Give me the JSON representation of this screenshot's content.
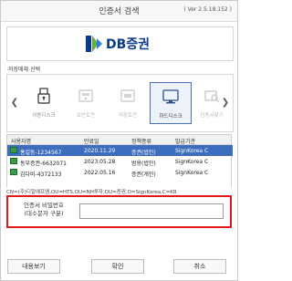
{
  "window": {
    "title": "인증서 검색",
    "version": "( Ver 2.5.18.152 )"
  },
  "logo": {
    "text": "DB증권"
  },
  "media": {
    "section_label": "저장매체 선택",
    "items": [
      {
        "label": "이동디스크",
        "icon": "usb-icon",
        "selected": false
      },
      {
        "label": "보안토큰",
        "icon": "token-icon",
        "selected": false
      },
      {
        "label": "저장토큰",
        "icon": "storage-token-icon",
        "selected": false
      },
      {
        "label": "하드디스크",
        "icon": "monitor-icon",
        "selected": true
      },
      {
        "label": "인증서찾기",
        "icon": "search-cert-icon",
        "selected": false
      }
    ]
  },
  "table": {
    "headers": [
      "사용자명",
      "만료일",
      "정책종류",
      "발급기관"
    ],
    "rows": [
      {
        "user": "홍길동-1234567",
        "expiry": "2020.11.29",
        "policy": "증권(법인)",
        "issuer": "SignKorea C",
        "selected": true
      },
      {
        "user": "동부증권-6632071",
        "expiry": "2023.05.28",
        "policy": "범용(법인)",
        "issuer": "SignKorea C",
        "selected": false
      },
      {
        "user": "김다비-4372133",
        "expiry": "2022.05.16",
        "policy": "증권(개인)",
        "issuer": "SignKorea C",
        "selected": false
      }
    ]
  },
  "dn": "CN=(주)디알에프엠,OU=HTS,OU=NH투자,OU=증권,O=SignKorea,C=KR",
  "password": {
    "label": "인증서 비밀번호\n(대소문자 구분)",
    "value": ""
  },
  "buttons": {
    "view": "내용보기",
    "confirm": "확인",
    "cancel": "취소"
  },
  "colors": {
    "accent": "#3d6dbd",
    "alert_frame": "#e01a1a",
    "logo_blue": "#0a3a8c",
    "logo_green": "#5fb343"
  }
}
